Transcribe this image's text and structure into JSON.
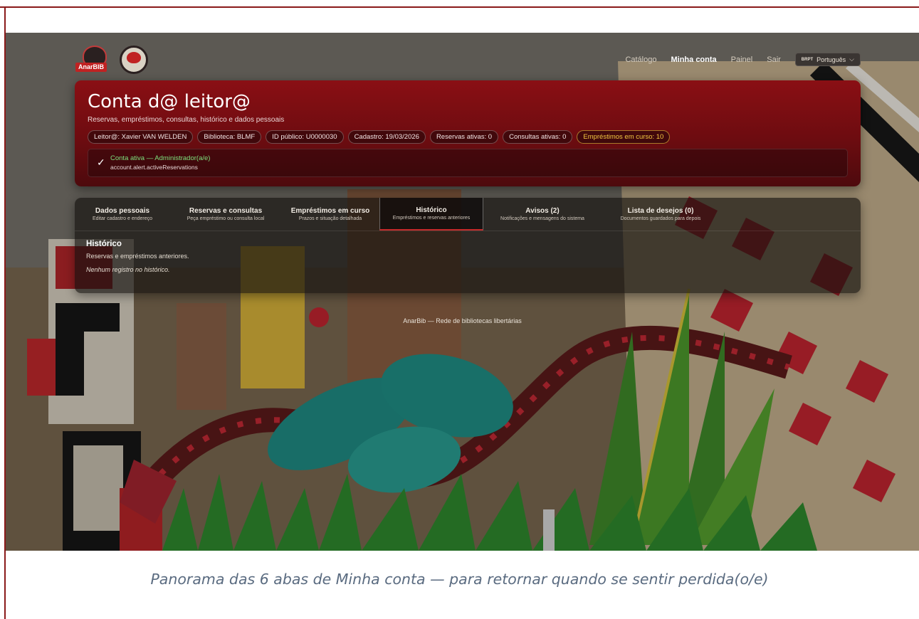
{
  "header": {
    "logo_text": "AnarBIB",
    "nav": {
      "catalog": "Catálogo",
      "my_account": "Minha conta",
      "panel": "Painel",
      "logout": "Sair"
    },
    "language": {
      "flag": "BRPT",
      "label": "Português"
    }
  },
  "account": {
    "title": "Conta d@ leitor@",
    "subtitle": "Reservas, empréstimos, consultas, histórico e dados pessoais",
    "chips": [
      "Leitor@: Xavier VAN WELDEN",
      "Biblioteca: BLMF",
      "ID público: U0000030",
      "Cadastro: 19/03/2026",
      "Reservas ativas: 0",
      "Consultas ativas: 0",
      "Empréstimos em curso: 10"
    ],
    "alert": {
      "check": "✓",
      "status": "Conta ativa — Administrador(a/e)",
      "key": "account.alert.activeReservations"
    }
  },
  "tabs": [
    {
      "label": "Dados pessoais",
      "desc": "Editar cadastro e endereço"
    },
    {
      "label": "Reservas e consultas",
      "desc": "Peça empréstimo ou consulta local"
    },
    {
      "label": "Empréstimos em curso",
      "desc": "Prazos e situação detalhada"
    },
    {
      "label": "Histórico",
      "desc": "Empréstimos e reservas anteriores"
    },
    {
      "label": "Avisos (2)",
      "desc": "Notificações e mensagens do sistema"
    },
    {
      "label": "Lista de desejos (0)",
      "desc": "Documentos guardados para depois"
    }
  ],
  "history": {
    "title": "Histórico",
    "desc": "Reservas e empréstimos anteriores.",
    "empty": "Nenhum registro no histórico."
  },
  "footer": "AnarBib — Rede de bibliotecas libertárias",
  "caption": "Panorama das 6 abas de Minha conta — para retornar quando se sentir perdida(o/e)",
  "colors": {
    "brand_red": "#8a0f14",
    "alert_green": "#7de07d",
    "warning_yellow": "#f2c641"
  }
}
